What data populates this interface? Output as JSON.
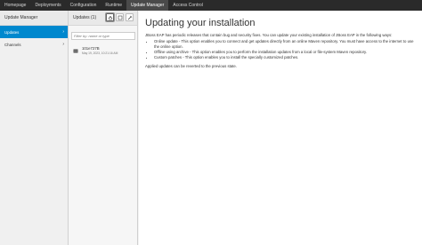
{
  "topnav": {
    "tabs": [
      {
        "label": "Homepage"
      },
      {
        "label": "Deployments"
      },
      {
        "label": "Configuration"
      },
      {
        "label": "Runtime"
      },
      {
        "label": "Update Manager",
        "active": true
      },
      {
        "label": "Access Control"
      }
    ]
  },
  "sidebar": {
    "title": "Update Manager",
    "items": [
      {
        "label": "Updates",
        "selected": true,
        "chevron": "›"
      },
      {
        "label": "Channels",
        "selected": false,
        "chevron": "›"
      }
    ]
  },
  "updates": {
    "title": "Updates (1)",
    "toolbar": {
      "update_online_icon": "update-online-icon",
      "update_offline_icon": "update-offline-icon",
      "patch_icon": "patch-icon"
    },
    "filter_placeholder": "Filter by: name or type",
    "items": [
      {
        "name": "101e727B",
        "date": "May 19, 2023, 10:21:16 AM",
        "icon": "server-icon"
      }
    ]
  },
  "main": {
    "heading": "Updating your installation",
    "intro": "JBoss EAP has periodic releases that contain bug and security fixes. You can update your existing installation of JBoss EAP in the following ways:",
    "bullets": [
      "Online update - This option enables you to connect and get updates directly from an online Maven repository. You must have access to the internet to use the online option.",
      "Offline using archive - This option enables you to perform the installation updates from a local or file-system Maven repository.",
      "Custom patches - This option enables you to install the specially customized patches."
    ],
    "outro": "Applied updates can be reverted to the previous state."
  },
  "colors": {
    "accent": "#0088ce",
    "topnav_bg": "#2a2a2a",
    "topnav_active": "#4a4a4a"
  }
}
